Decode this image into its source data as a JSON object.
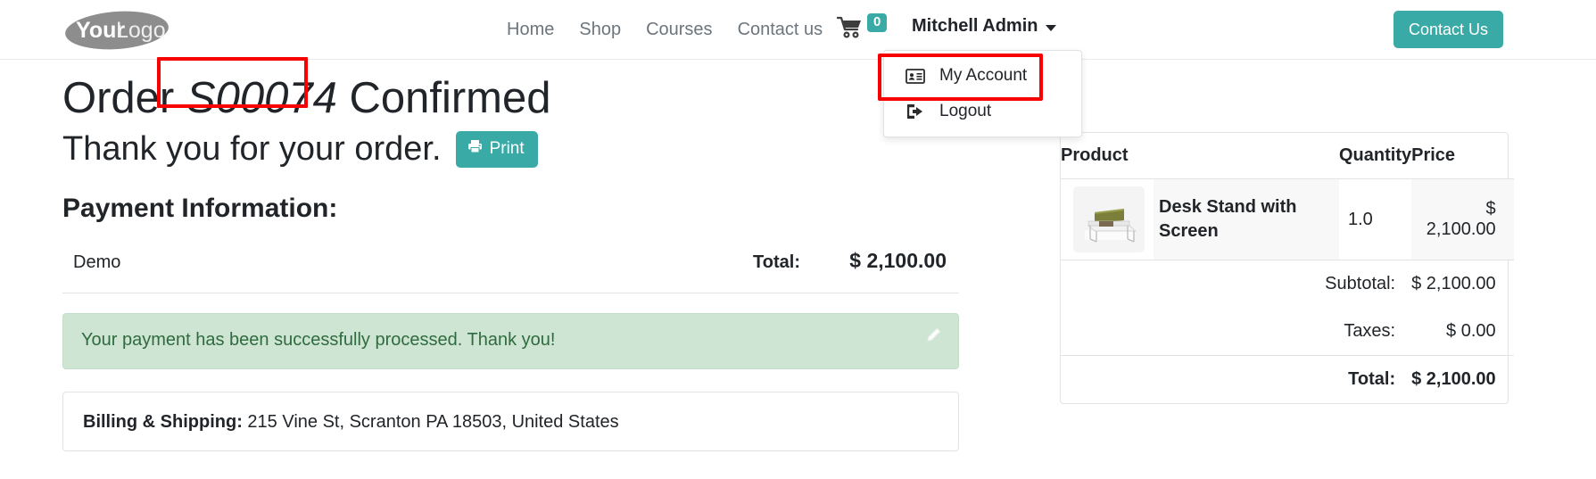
{
  "header": {
    "logo_text_bold": "Your",
    "logo_text_light": "Logo",
    "nav": [
      {
        "label": "Home",
        "name": "nav-home"
      },
      {
        "label": "Shop",
        "name": "nav-shop"
      },
      {
        "label": "Courses",
        "name": "nav-courses"
      },
      {
        "label": "Contact us",
        "name": "nav-contact-us"
      }
    ],
    "cart": {
      "icon": "cart-icon",
      "count": "0"
    },
    "user": {
      "name": "Mitchell Admin",
      "caret_icon": "chevron-down-icon"
    },
    "contact_button": "Contact Us"
  },
  "user_dropdown": {
    "items": [
      {
        "label": "My Account",
        "icon": "id-card-icon",
        "highlighted": true
      },
      {
        "label": "Logout",
        "icon": "sign-out-icon",
        "highlighted": false
      }
    ]
  },
  "order": {
    "title_prefix": "Order",
    "reference": "S00074",
    "title_suffix": "Confirmed",
    "thank_you": "Thank you for your order.",
    "print_button": "Print",
    "print_icon": "printer-icon"
  },
  "payment": {
    "heading": "Payment Information:",
    "method": "Demo",
    "total_label": "Total:",
    "total_value": "$ 2,100.00"
  },
  "alert": {
    "message": "Your payment has been successfully processed. Thank you!",
    "edit_icon": "pencil-icon",
    "background_color": "#cfe5d3",
    "text_color": "#2f6b3e"
  },
  "billing": {
    "label": "Billing & Shipping:",
    "address": "215 Vine St, Scranton PA 18503, United States"
  },
  "summary": {
    "columns": {
      "product": "Product",
      "quantity": "Quantity",
      "price": "Price"
    },
    "lines": [
      {
        "product": "Desk Stand with Screen",
        "quantity": "1.0",
        "price": "$ 2,100.00",
        "thumbnail": "desk-stand-with-screen-image"
      }
    ],
    "subtotal_label": "Subtotal:",
    "subtotal_value": "$ 2,100.00",
    "taxes_label": "Taxes:",
    "taxes_value": "$ 0.00",
    "total_label": "Total:",
    "total_value": "$ 2,100.00"
  },
  "theme": {
    "accent": "#3aaaa6",
    "annotation": "#f60000",
    "muted_text": "#6c757d"
  }
}
